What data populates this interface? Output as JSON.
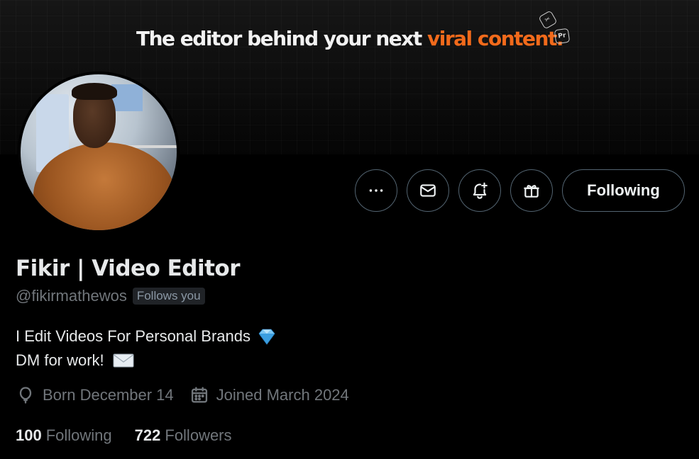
{
  "banner": {
    "tagline_main": "The editor behind your next",
    "tagline_accent": "viral content.",
    "accent_color": "#f26a1b",
    "badges": [
      {
        "icon": "capcut-logo-icon",
        "text": "✂"
      },
      {
        "icon": "premiere-pro-logo-icon",
        "text": "Pr"
      }
    ]
  },
  "profile": {
    "display_name": "Fikir | Video Editor",
    "handle": "@fikirmathewos",
    "follows_you": "Follows you",
    "bio_line1": "I Edit Videos For Personal Brands",
    "bio_line2": "DM for work!",
    "birthday": "Born December 14",
    "joined": "Joined March 2024",
    "following_count": "100",
    "following_label": "Following",
    "followers_count": "722",
    "followers_label": "Followers"
  },
  "actions": {
    "more_icon": "more-horizontal-icon",
    "message_icon": "envelope-icon",
    "notify_icon": "bell-plus-icon",
    "gift_icon": "gift-icon",
    "follow_button": "Following"
  },
  "colors": {
    "background": "#000000",
    "text_primary": "#e7e9ea",
    "text_secondary": "#71767b",
    "border": "#536471"
  }
}
